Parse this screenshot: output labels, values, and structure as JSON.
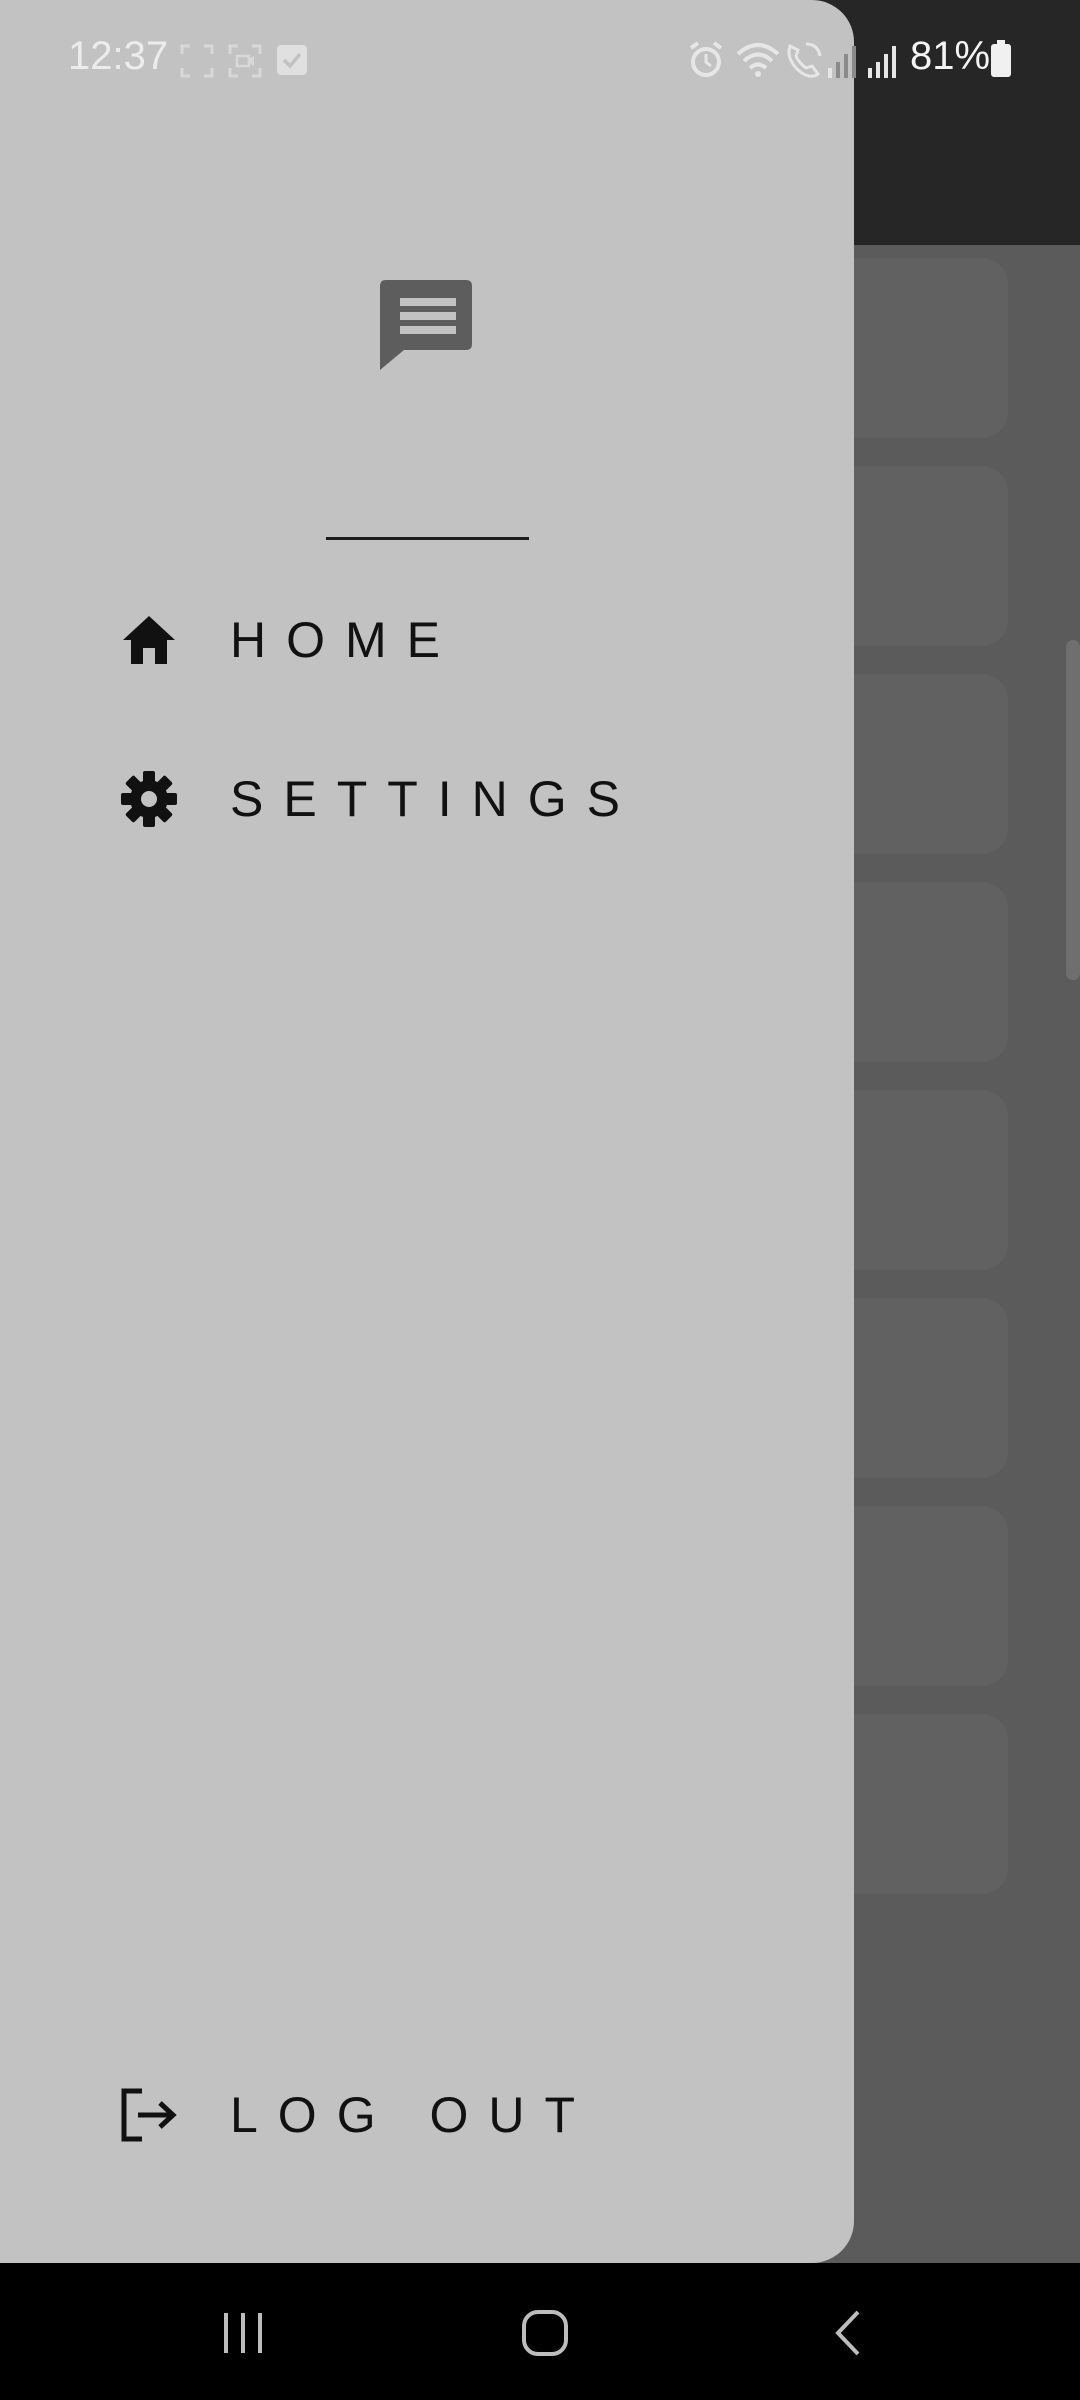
{
  "status_bar": {
    "time": "12:37",
    "battery_percent": "81%",
    "left_icons": [
      "screenshot-icon",
      "screen-record-icon",
      "check-box-icon"
    ],
    "right_icons": [
      "alarm-icon",
      "wifi-icon",
      "wifi-call-icon",
      "signal-weak-icon",
      "signal-icon",
      "battery-icon"
    ]
  },
  "drawer": {
    "logo_icon": "chat-message-icon",
    "menu": [
      {
        "label": "HOME",
        "icon": "home-icon"
      },
      {
        "label": "SETTINGS",
        "icon": "gear-icon"
      }
    ],
    "logout": {
      "label": "LOG OUT",
      "icon": "logout-icon"
    }
  },
  "system_nav": {
    "buttons": [
      "recent-apps-icon",
      "home-circle-icon",
      "back-icon"
    ]
  },
  "colors": {
    "drawer_bg": "#c2c2c2",
    "scrim": "#5b5b5b",
    "top_bar": "#262626",
    "nav_bar": "#000000"
  }
}
